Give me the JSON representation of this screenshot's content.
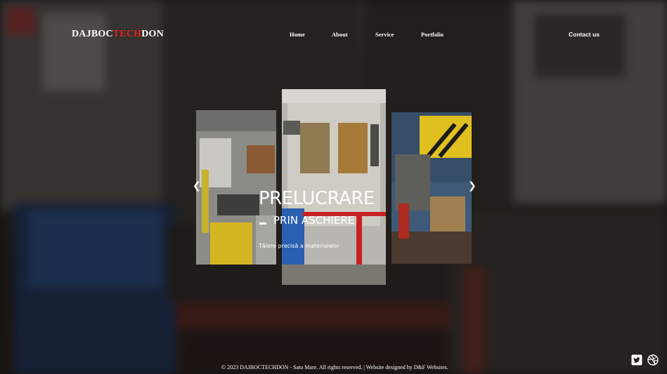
{
  "logo": {
    "part1": "DAJBOC",
    "part2": "TECH",
    "part3": "DON"
  },
  "nav": {
    "home": "Home",
    "about": "About",
    "service": "Service",
    "portfolio": "Portfolio"
  },
  "contact_label": "Contact us",
  "hero": {
    "title": "PRELUCRARE",
    "subtitle": "PRIN ASCHIERE",
    "tagline": "Tăiere precisă a materialelor"
  },
  "carousel": {
    "prev_icon": "chevron-left-icon",
    "next_icon": "chevron-right-icon"
  },
  "footer": {
    "text": "© 2023 DAJBOCTECHDON - Satu Mare. All rights reserved. | Website designed by D&F Websites."
  },
  "social": {
    "icons": [
      "twitter-icon",
      "dribbble-icon"
    ]
  },
  "colors": {
    "accent": "#e0231f",
    "text": "#ffffff"
  }
}
